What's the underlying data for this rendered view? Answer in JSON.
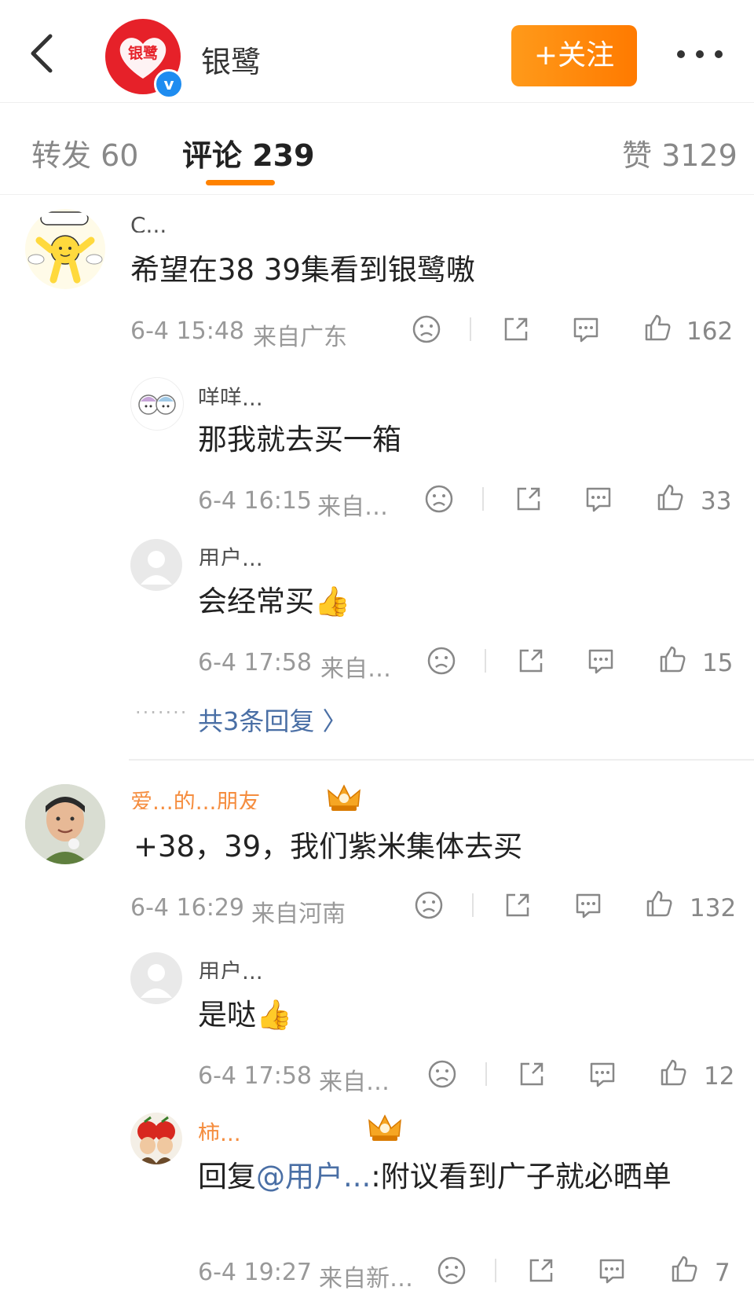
{
  "header": {
    "brand_name": "银鹭",
    "avatar_logo_text": "银鹭",
    "verified_mark": "v",
    "follow_label": "+关注",
    "accent_color": "#ff8200"
  },
  "tabs": [
    {
      "label": "转发 60",
      "active": false
    },
    {
      "label": "评论 239",
      "active": true
    },
    {
      "label": "赞 3129",
      "active": false
    }
  ],
  "comments": [
    {
      "username": "C...",
      "text": "希望在38 39集看到银鹭嗷",
      "time": "6-4 15:48",
      "location": "来自广东",
      "likes": "162",
      "replies": [
        {
          "username": "咩咩...",
          "text": "那我就去买一箱",
          "time": "6-4 16:15",
          "location": "来自…",
          "likes": "33"
        },
        {
          "username": "用户...",
          "text": "会经常买👍",
          "time": "6-4 17:58",
          "location": "来自…",
          "likes": "15"
        }
      ],
      "more_replies_label": "共3条回复 〉"
    },
    {
      "username": "爱...的...朋友",
      "text": "+38，39，我们紫米集体去买",
      "time": "6-4 16:29",
      "location": "来自河南",
      "likes": "132",
      "replies": [
        {
          "username": "用户...",
          "text": "是哒👍",
          "time": "6-4 17:58",
          "location": "来自…",
          "likes": "12"
        },
        {
          "username": "柿...",
          "text_prefix": "回复",
          "mention": "@用户...",
          "text": ":附议看到广子就必晒单",
          "time": "6-4 19:27",
          "location": "来自新…",
          "likes": "7"
        }
      ]
    }
  ],
  "icons": {
    "dislike": "sad-face-icon",
    "share": "share-icon",
    "comment": "comment-icon",
    "like": "thumbs-up-icon"
  }
}
